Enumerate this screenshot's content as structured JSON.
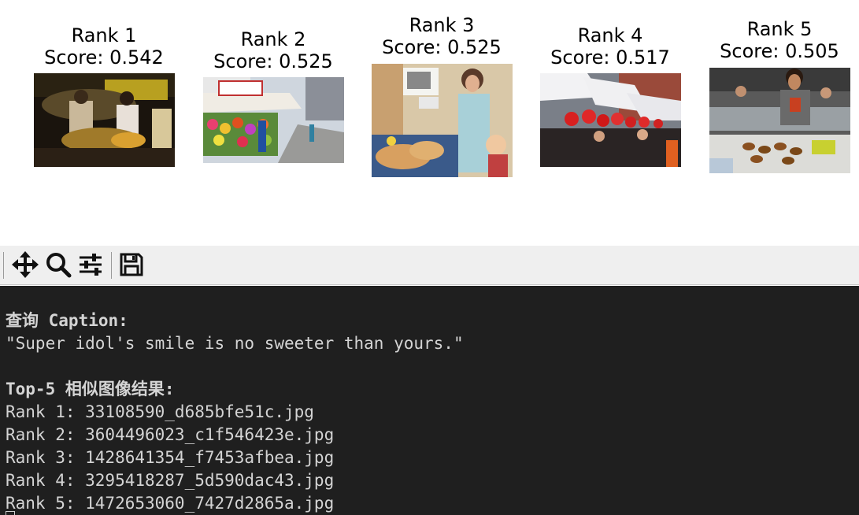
{
  "figure": {
    "panels": [
      {
        "rank_label": "Rank 1",
        "score_label": "Score: 0.542",
        "image_icon": "night-market-food-stall-photo"
      },
      {
        "rank_label": "Rank 2",
        "score_label": "Score: 0.525",
        "image_icon": "street-flower-fruit-stand-photo"
      },
      {
        "rank_label": "Rank 3",
        "score_label": "Score: 0.525",
        "image_icon": "kitchen-woman-child-photo"
      },
      {
        "rank_label": "Rank 4",
        "score_label": "Score: 0.517",
        "image_icon": "lantern-street-market-photo"
      },
      {
        "rank_label": "Rank 5",
        "score_label": "Score: 0.505",
        "image_icon": "chef-plating-dishes-photo"
      }
    ]
  },
  "toolbar": {
    "buttons": [
      {
        "icon": "pan-move-icon"
      },
      {
        "icon": "zoom-magnifier-icon"
      },
      {
        "icon": "subplot-sliders-icon"
      },
      {
        "icon": "save-floppy-icon"
      }
    ]
  },
  "terminal": {
    "query_label": "查询 Caption:",
    "query_text": "\"Super idol's smile is no sweeter than yours.\"",
    "results_label": "Top-5 相似图像结果:",
    "results": [
      "Rank 1: 33108590_d685bfe51c.jpg",
      "Rank 2: 3604496023_c1f546423e.jpg",
      "Rank 3: 1428641354_f7453afbea.jpg",
      "Rank 4: 3295418287_5d590dac43.jpg",
      "Rank 5: 1472653060_7427d2865a.jpg"
    ]
  }
}
